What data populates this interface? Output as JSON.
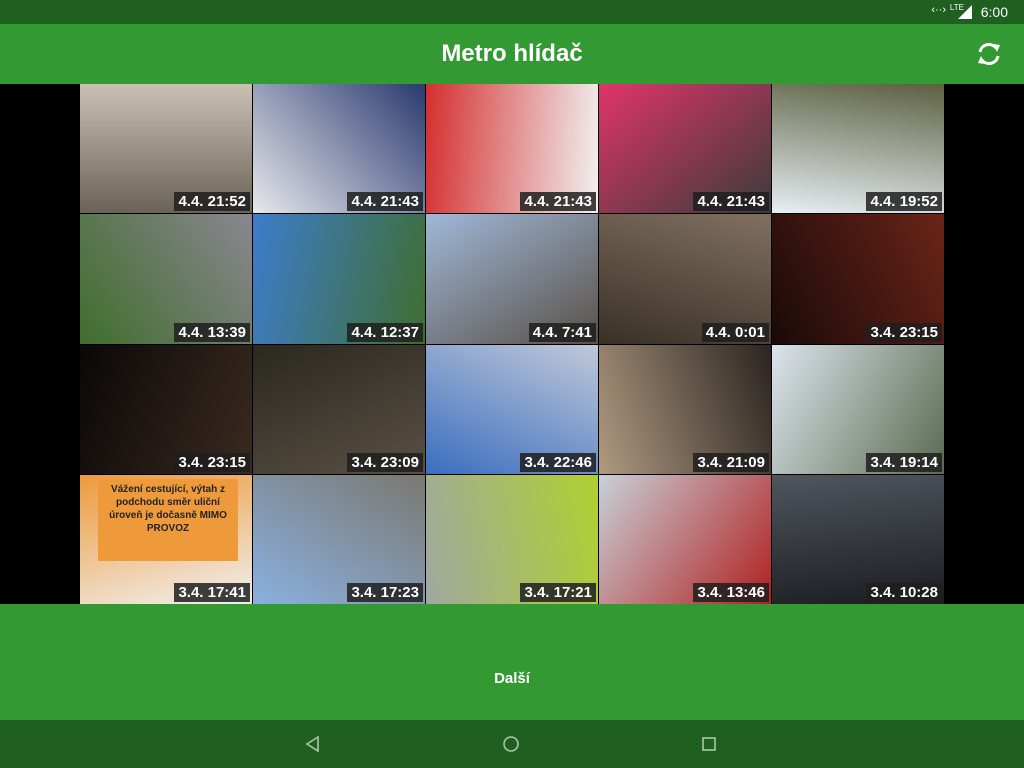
{
  "status_bar": {
    "time": "6:00",
    "network": "LTE"
  },
  "app_bar": {
    "title": "Metro hlídač",
    "refresh_icon": "refresh-icon"
  },
  "photos": [
    {
      "timestamp": "4.4. 21:52",
      "colors": [
        "#6b6258",
        "#c9c2b4"
      ]
    },
    {
      "timestamp": "4.4. 21:43",
      "colors": [
        "#e8e8ec",
        "#2a3a70"
      ]
    },
    {
      "timestamp": "4.4. 21:43",
      "colors": [
        "#d52f2f",
        "#f1f1f1"
      ]
    },
    {
      "timestamp": "4.4. 21:43",
      "colors": [
        "#e0346a",
        "#3b3b3b"
      ]
    },
    {
      "timestamp": "4.4. 19:52",
      "colors": [
        "#e8eef4",
        "#5b6040"
      ]
    },
    {
      "timestamp": "4.4. 13:39",
      "colors": [
        "#3f6e2c",
        "#8a8690"
      ]
    },
    {
      "timestamp": "4.4. 12:37",
      "colors": [
        "#3d7ccc",
        "#3f6e30"
      ]
    },
    {
      "timestamp": "4.4. 7:41",
      "colors": [
        "#9fb8d8",
        "#5a5048"
      ]
    },
    {
      "timestamp": "4.4. 0:01",
      "colors": [
        "#3a3026",
        "#807060"
      ]
    },
    {
      "timestamp": "3.4. 23:15",
      "colors": [
        "#1a0a08",
        "#6a2418"
      ]
    },
    {
      "timestamp": "3.4. 23:15",
      "colors": [
        "#0a0808",
        "#3a2a20"
      ]
    },
    {
      "timestamp": "3.4. 23:09",
      "colors": [
        "#2a2820",
        "#5a5044"
      ]
    },
    {
      "timestamp": "3.4. 22:46",
      "colors": [
        "#3a6ec0",
        "#c0c8d8"
      ]
    },
    {
      "timestamp": "3.4. 21:09",
      "colors": [
        "#b09a80",
        "#2a2420"
      ]
    },
    {
      "timestamp": "3.4. 19:14",
      "colors": [
        "#dce4ec",
        "#5a6a50"
      ]
    },
    {
      "timestamp": "3.4. 17:41",
      "colors": [
        "#ee9a3a",
        "#f0f0f0"
      ]
    },
    {
      "timestamp": "3.4. 17:23",
      "colors": [
        "#8ab0e0",
        "#7a7870"
      ]
    },
    {
      "timestamp": "3.4. 17:21",
      "colors": [
        "#a0a8a0",
        "#b0d030"
      ]
    },
    {
      "timestamp": "3.4. 13:46",
      "colors": [
        "#c8d0d8",
        "#b02020"
      ]
    },
    {
      "timestamp": "3.4. 10:28",
      "colors": [
        "#50565e",
        "#1a1c20"
      ]
    }
  ],
  "sign_text": "Vážení cestující, výtah z podchodu směr uliční úroveň je dočasně MIMO PROVOZ",
  "footer": {
    "next_label": "Další"
  },
  "colors": {
    "status": "#1f5f1f",
    "primary": "#339933"
  }
}
